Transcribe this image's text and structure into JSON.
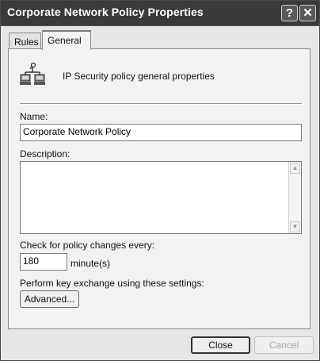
{
  "window": {
    "title": "Corporate Network Policy Properties",
    "help_glyph": "?",
    "close_glyph": "✕"
  },
  "tabs": [
    {
      "label": "Rules",
      "selected": false
    },
    {
      "label": "General",
      "selected": true
    }
  ],
  "general": {
    "header_icon": "network-computers-icon",
    "header_text": "IP Security policy general properties",
    "name_label": "Name:",
    "name_value": "Corporate Network Policy",
    "description_label": "Description:",
    "description_value": "",
    "check_label": "Check for policy changes every:",
    "check_value": "180",
    "check_unit": "minute(s)",
    "key_exchange_label": "Perform key exchange using these settings:",
    "advanced_button": "Advanced..."
  },
  "footer": {
    "close_button": "Close",
    "cancel_button": "Cancel",
    "cancel_enabled": false
  }
}
